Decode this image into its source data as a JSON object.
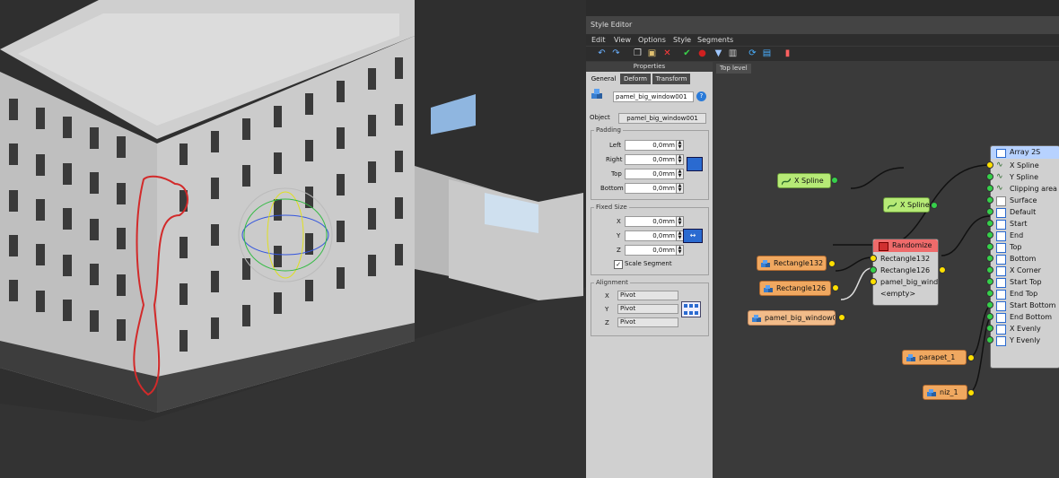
{
  "editor": {
    "title": "Style Editor",
    "menu": [
      "Edit",
      "View",
      "Options",
      "Style",
      "Segments"
    ]
  },
  "toolbar_icons": [
    "undo-icon",
    "redo-icon",
    "copy-icon",
    "paste-icon",
    "delete-icon",
    "apply-icon",
    "stop-icon",
    "filter-icon",
    "trash-icon",
    "refresh-icon",
    "export-icon",
    "book-icon"
  ],
  "properties": {
    "header": "Properties",
    "tabs": [
      "General",
      "Deform",
      "Transform"
    ],
    "name_value": "pamel_big_window001",
    "help": "?",
    "object_label": "Object",
    "object_value": "pamel_big_window001",
    "padding": {
      "title": "Padding",
      "fields": [
        {
          "label": "Left",
          "value": "0,0mm"
        },
        {
          "label": "Right",
          "value": "0,0mm"
        },
        {
          "label": "Top",
          "value": "0,0mm"
        },
        {
          "label": "Bottom",
          "value": "0,0mm"
        }
      ]
    },
    "fixed_size": {
      "title": "Fixed Size",
      "fields": [
        {
          "label": "X",
          "value": "0,0mm"
        },
        {
          "label": "Y",
          "value": "0,0mm"
        },
        {
          "label": "Z",
          "value": "0,0mm"
        }
      ],
      "checkbox_label": "Scale Segment",
      "checkbox_checked": true
    },
    "alignment": {
      "title": "Alignment",
      "fields": [
        {
          "label": "X",
          "value": "Pivot"
        },
        {
          "label": "Y",
          "value": "Pivot"
        },
        {
          "label": "Z",
          "value": "Pivot"
        }
      ]
    }
  },
  "graph": {
    "tab": "Top level",
    "nodes": {
      "xspline1": "X Spline",
      "xspline2": "X Spline",
      "rect132": "Rectangle132",
      "rect126": "Rectangle126",
      "pamel": "pamel_big_window0",
      "parapet": "parapet_1",
      "niz": "niz_1"
    },
    "randomize": {
      "title": "Randomize",
      "rows": [
        "Rectangle132",
        "Rectangle126",
        "pamel_big_wind",
        "<empty>"
      ]
    },
    "array": {
      "title": "Array 2S",
      "rows": [
        "X Spline",
        "Y Spline",
        "Clipping area",
        "Surface",
        "Default",
        "Start",
        "End",
        "Top",
        "Bottom",
        "X Corner",
        "Start Top",
        "End Top",
        "Start Bottom",
        "End Bottom",
        "X Evenly",
        "Y Evenly"
      ]
    }
  },
  "colors": {
    "spline_node": "#b6ea76",
    "object_node": "#f0a860",
    "randomize_header": "#ef6b6b",
    "array_header": "#b7d2ff",
    "annotation_stroke": "#d22a2a"
  }
}
